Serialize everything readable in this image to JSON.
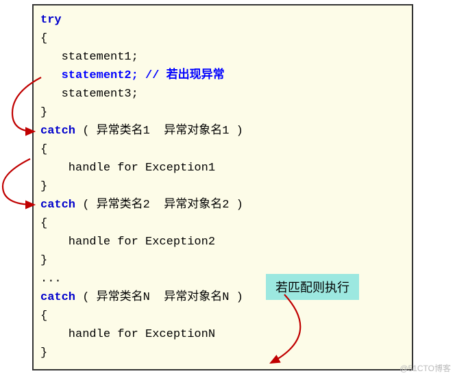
{
  "code": {
    "try_kw": "try",
    "brace_open": "{",
    "brace_close": "}",
    "stmt1": "   statement1;",
    "stmt2_pre": "   ",
    "stmt2": "statement2;",
    "stmt2_space": " ",
    "stmt2_comment": "// 若出现异常",
    "stmt3": "   statement3;",
    "catch1_kw": "catch",
    "catch1_args": " ( 异常类名1  异常对象名1 )",
    "handle1": "    handle for Exception1",
    "catch2_kw": "catch",
    "catch2_args": " ( 异常类名2  异常对象名2 )",
    "handle2": "    handle for Exception2",
    "dots": "...",
    "catchN_kw": "catch",
    "catchN_args": " ( 异常类名N  异常对象名N )",
    "handleN": "    handle for ExceptionN"
  },
  "label": "若匹配则执行",
  "watermark": "@51CTO博客"
}
